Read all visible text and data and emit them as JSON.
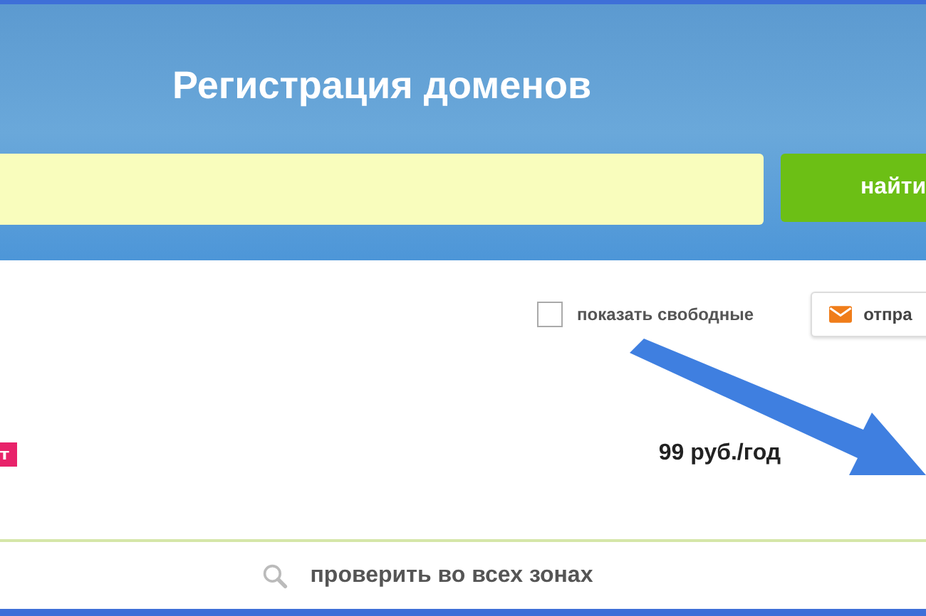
{
  "header": {
    "title": "Регистрация доменов"
  },
  "search": {
    "button": "найти"
  },
  "filters": {
    "show_free": {
      "label": "показать свободные",
      "checked": false
    },
    "send_button": "отпра"
  },
  "result": {
    "tag": "т",
    "price": "99 руб./год"
  },
  "check_all": {
    "label": "проверить во всех зонах"
  }
}
